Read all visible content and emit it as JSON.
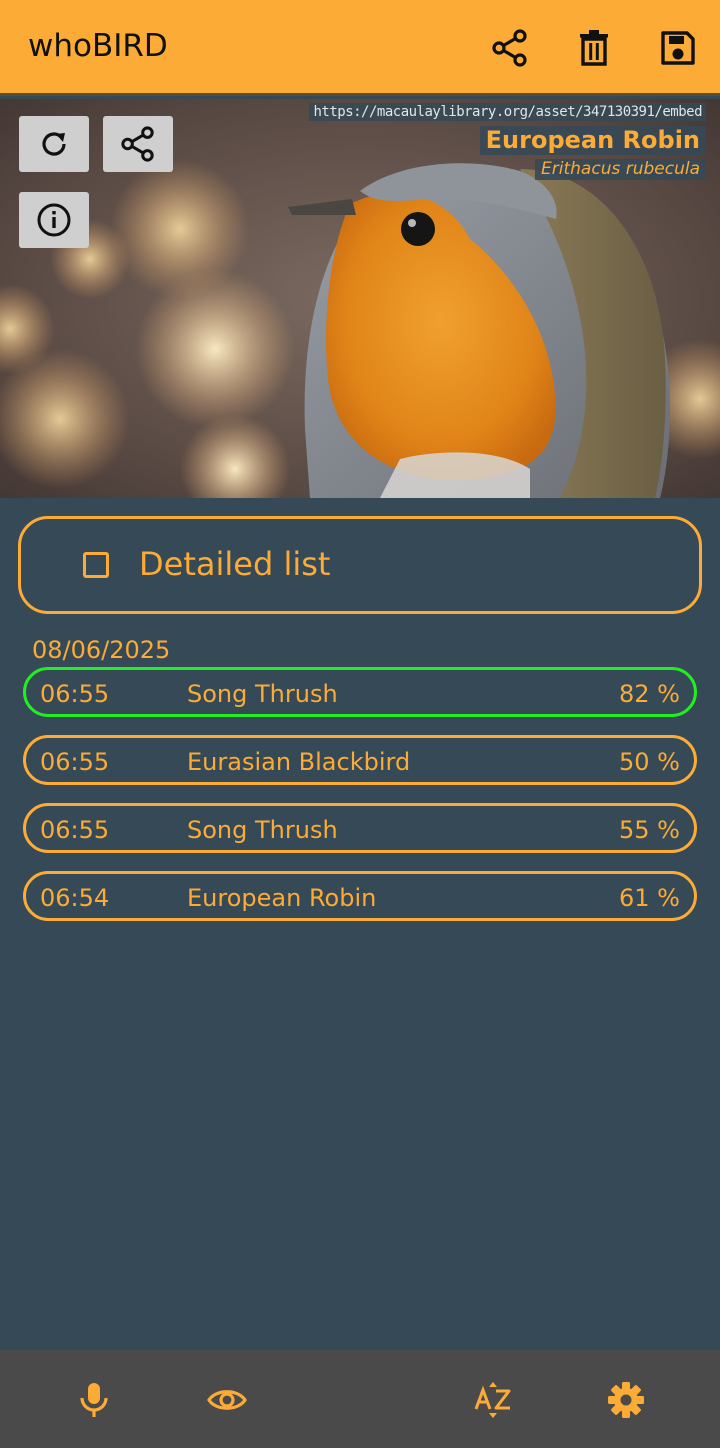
{
  "app": {
    "title": "whoBIRD"
  },
  "toolbar": {
    "share_icon": "share-icon",
    "delete_icon": "trash-icon",
    "save_icon": "save-icon"
  },
  "hero": {
    "source_url": "https://macaulaylibrary.org/asset/347130391/embed",
    "common_name": "European Robin",
    "latin_name": "Erithacus rubecula",
    "buttons": [
      "refresh-icon",
      "share-icon",
      "info-icon"
    ]
  },
  "detail_toggle": {
    "label": "Detailed list",
    "checked": false
  },
  "list": {
    "date": "08/06/2025",
    "rows": [
      {
        "time": "06:55",
        "name": "Song Thrush",
        "confidence": "82 %",
        "active": true
      },
      {
        "time": "06:55",
        "name": "Eurasian Blackbird",
        "confidence": "50 %",
        "active": false
      },
      {
        "time": "06:55",
        "name": "Song Thrush",
        "confidence": "55 %",
        "active": false
      },
      {
        "time": "06:54",
        "name": "European Robin",
        "confidence": "61 %",
        "active": false
      }
    ]
  },
  "bottom_nav": {
    "items": [
      "microphone-icon",
      "eye-icon",
      "sort-az-icon",
      "settings-icon"
    ]
  },
  "colors": {
    "accent": "#fbab36",
    "background": "#364956",
    "active_border": "#22ee22",
    "bottom_bar": "#4a4a4a"
  }
}
